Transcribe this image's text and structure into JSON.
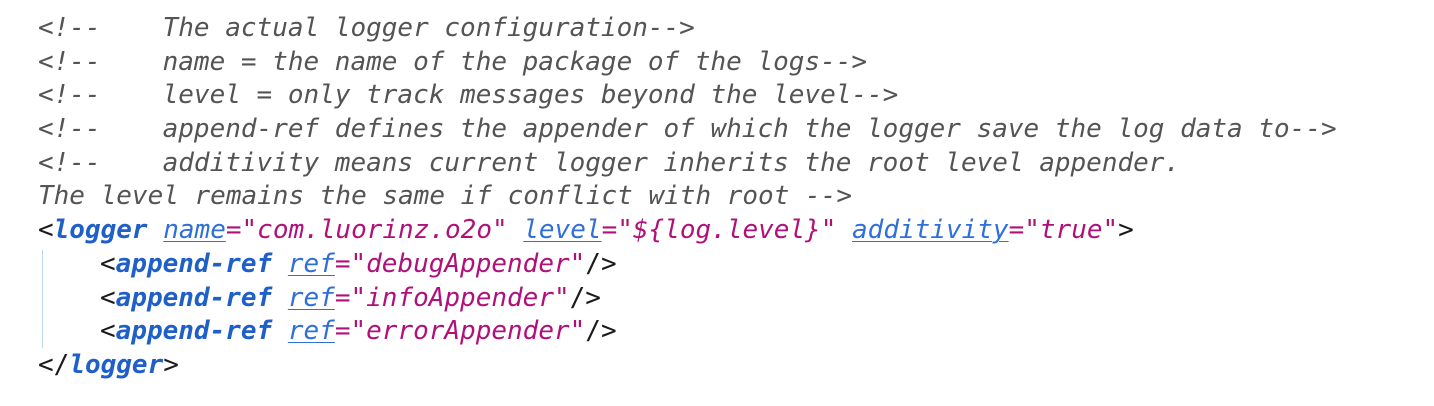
{
  "comments": [
    {
      "open": "<!--",
      "text": "The actual logger configuration-->"
    },
    {
      "open": "<!--",
      "text": "name = the name of the package of the logs-->"
    },
    {
      "open": "<!--",
      "text": "level = only track messages beyond the level-->"
    },
    {
      "open": "<!--",
      "text": "append-ref defines the appender of which the logger save the log data to-->"
    },
    {
      "open": "<!--",
      "text": "additivity means current logger inherits the root level appender."
    }
  ],
  "comment_continuation": "The level remains the same if conflict with root -->",
  "logger": {
    "tag": "logger",
    "attrs": [
      {
        "name": "name",
        "value": "\"com.luorinz.o2o\""
      },
      {
        "name": "level",
        "value": "\"${log.level}\""
      },
      {
        "name": "additivity",
        "value": "\"true\""
      }
    ],
    "children": [
      {
        "tag": "append-ref",
        "attr": "ref",
        "value": "\"debugAppender\""
      },
      {
        "tag": "append-ref",
        "attr": "ref",
        "value": "\"infoAppender\""
      },
      {
        "tag": "append-ref",
        "attr": "ref",
        "value": "\"errorAppender\""
      }
    ],
    "close_tag": "logger"
  },
  "colors": {
    "comment": "#545454",
    "tag": "#1f5fc8",
    "attribute": "#2f6fd8",
    "value": "#b0107a",
    "indent_guide": "#b9d6ee"
  }
}
